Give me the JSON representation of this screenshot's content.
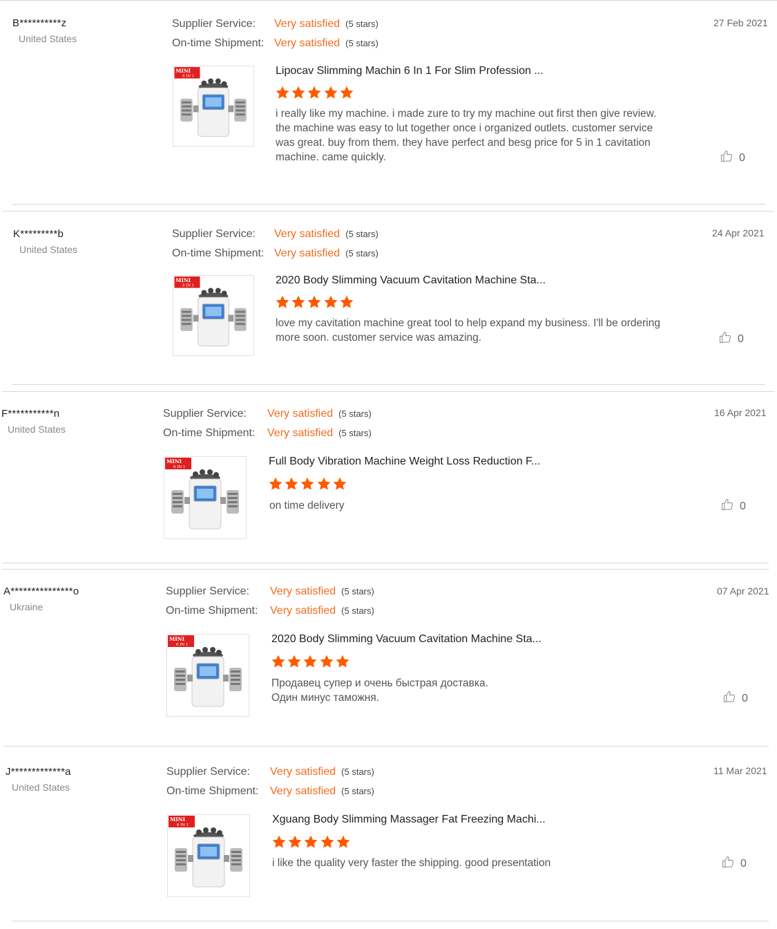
{
  "labels": {
    "supplier_service": "Supplier Service:",
    "on_time_shipment": "On-time Shipment:"
  },
  "colors": {
    "accent": "#f46b1e",
    "star": "#ff5a00",
    "divider": "#e4e4e4"
  },
  "thumbnail_badge": "MINI",
  "thumbnail_badge_sub": "6 IN 1",
  "reviews": [
    {
      "username": "B**********z",
      "country": "United States",
      "supplier_service": "Very satisfied",
      "supplier_stars_text": "(5 stars)",
      "shipment": "Very satisfied",
      "shipment_stars_text": "(5 stars)",
      "date": "27 Feb 2021",
      "product_title": "Lipocav Slimming Machin 6 In 1 For Slim Profession ...",
      "rating": 5,
      "text": "i really like my machine.  i made zure to try my machine out first then give review.  the machine was easy to lut together once i organized outlets.  customer service was great.  buy from them.  they have perfect and besg price for 5 in 1 cavitation machine. came quickly.",
      "helpful_count": "0"
    },
    {
      "username": "K*********b",
      "country": "United States",
      "supplier_service": "Very satisfied",
      "supplier_stars_text": "(5 stars)",
      "shipment": "Very satisfied",
      "shipment_stars_text": "(5 stars)",
      "date": "24 Apr 2021",
      "product_title": "2020 Body Slimming Vacuum Cavitation Machine Sta...",
      "rating": 5,
      "text": "love my cavitation machine great tool to help expand my business. I'll be ordering more soon. customer service was amazing.",
      "helpful_count": "0"
    },
    {
      "username": "F***********n",
      "country": "United States",
      "supplier_service": "Very satisfied",
      "supplier_stars_text": "(5 stars)",
      "shipment": "Very satisfied",
      "shipment_stars_text": "(5 stars)",
      "date": "16 Apr 2021",
      "product_title": "Full Body Vibration Machine Weight Loss Reduction F...",
      "rating": 5,
      "text": "on time delivery",
      "helpful_count": "0"
    },
    {
      "username": "A***************o",
      "country": "Ukraine",
      "supplier_service": "Very satisfied",
      "supplier_stars_text": "(5 stars)",
      "shipment": "Very satisfied",
      "shipment_stars_text": "(5 stars)",
      "date": "07 Apr 2021",
      "product_title": "2020 Body Slimming Vacuum Cavitation Machine Sta...",
      "rating": 5,
      "text": "Продавец супер и очень быстрая доставка.\nОдин минус таможня.",
      "helpful_count": "0"
    },
    {
      "username": "J*************a",
      "country": "United States",
      "supplier_service": "Very satisfied",
      "supplier_stars_text": "(5 stars)",
      "shipment": "Very satisfied",
      "shipment_stars_text": "(5 stars)",
      "date": "11 Mar 2021",
      "product_title": "Xguang Body Slimming Massager Fat Freezing Machi...",
      "rating": 5,
      "text": "i like the quality very faster the shipping. good presentation",
      "helpful_count": "0"
    }
  ]
}
